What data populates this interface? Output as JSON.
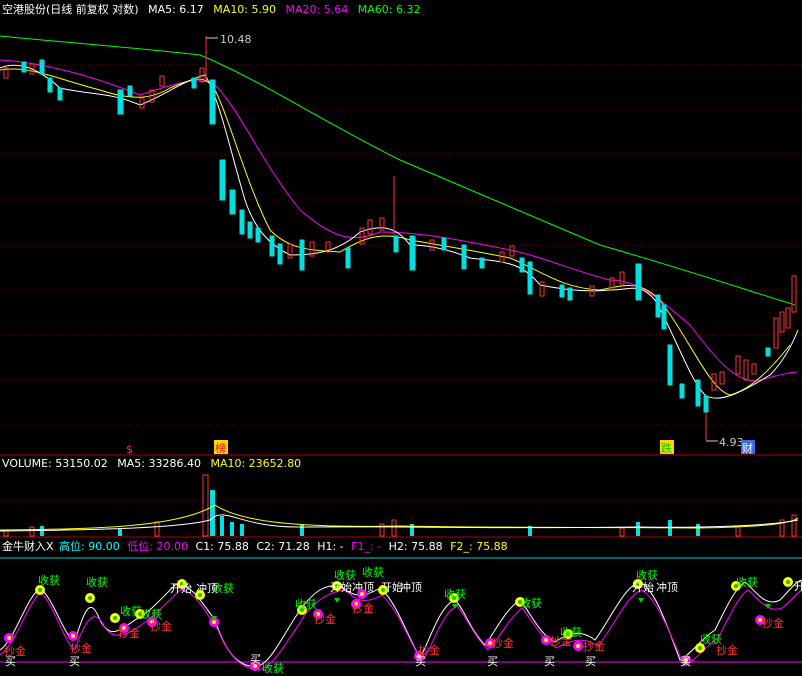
{
  "main_panel": {
    "title": "空港股份(日线 前复权 对数)",
    "ma5": "MA5: 6.17",
    "ma10": "MA10: 5.90",
    "ma20": "MA20: 5.64",
    "ma60": "MA60: 6.32",
    "high_label": "10.48",
    "low_label": "4.93",
    "markers": [
      "$",
      "榜",
      "跌",
      "财"
    ]
  },
  "volume_panel": {
    "title": "VOLUME: 53150.02",
    "ma5": "MA5: 33286.40",
    "ma10": "MA10: 23652.80"
  },
  "indicator_panel": {
    "title": "金牛财入X",
    "high": "高位: 90.00",
    "low": "低位: 20.00",
    "c1": "C1: 75.88",
    "c2": "C2: 71.28",
    "h1": "H1: -",
    "f1": "F1_: -",
    "h2": "H2: 75.88",
    "f2": "F2_: 75.88",
    "signals": {
      "buy": "买",
      "gold": "抄金",
      "harvest": "收获",
      "top": "冲顶",
      "start": "开始"
    }
  },
  "colors": {
    "up": "#ff3232",
    "down": "#00e0e0",
    "ma5": "#ffffff",
    "ma10": "#ffff00",
    "ma20": "#ff00ff",
    "ma60": "#00ff00",
    "grid": "#8b0000",
    "label": "#ff6060"
  }
}
